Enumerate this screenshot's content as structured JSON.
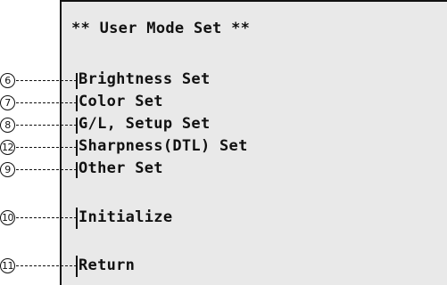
{
  "title": "** User Mode Set **",
  "menu": [
    {
      "number": "6",
      "label": "Brightness Set"
    },
    {
      "number": "7",
      "label": "Color Set"
    },
    {
      "number": "8",
      "label": "G/L, Setup Set"
    },
    {
      "number": "12",
      "label": "Sharpness(DTL) Set"
    },
    {
      "number": "9",
      "label": "Other Set"
    },
    {
      "number": "10",
      "label": "Initialize"
    },
    {
      "number": "11",
      "label": "Return"
    }
  ]
}
